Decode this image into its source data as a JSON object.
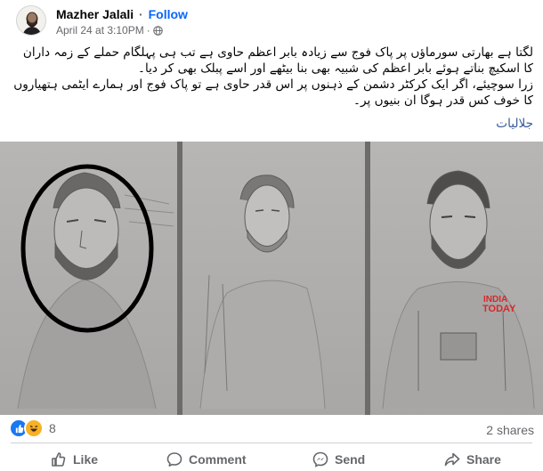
{
  "post": {
    "author": "Mazher Jalali",
    "separator": "·",
    "follow_label": "Follow",
    "timestamp": "April 24 at 3:10PM",
    "privacy_icon": "globe-icon",
    "text_line1": "لگتا ہے بھارتی سورماؤں پر پاک فوج سے زیادہ بابر اعظم حاوی ہے تب ہی پہلگام حملے کے زمہ داران کا اسکیچ بناتے ہوئے بابر اعظم کی شبیہ بھی بنا بیٹھے اور اسے پبلک بھی کر دیا۔",
    "text_line2": "زرا سوچیئے، اگر ایک کرکٹر دشمن کے ذہنوں پر اس قدر حاوی ہے تو پاک فوج اور ہمارے ایٹمی ہتھیاروں کا خوف کس قدر ہوگا ان بنیوں پر۔",
    "hashtag": "جلالیات"
  },
  "image": {
    "description_panels": 3,
    "watermark_line1": "INDIA",
    "watermark_line2": "TODAY",
    "circle_color": "#000000"
  },
  "stats": {
    "reaction_icons": [
      "like-icon",
      "haha-icon"
    ],
    "reaction_count": "8",
    "shares": "2 shares"
  },
  "actions": {
    "like": "Like",
    "comment": "Comment",
    "send": "Send",
    "share": "Share"
  },
  "colors": {
    "link": "#0866ff",
    "secondary_text": "#65676b",
    "hashtag": "#385898",
    "watermark": "#d8262c"
  }
}
